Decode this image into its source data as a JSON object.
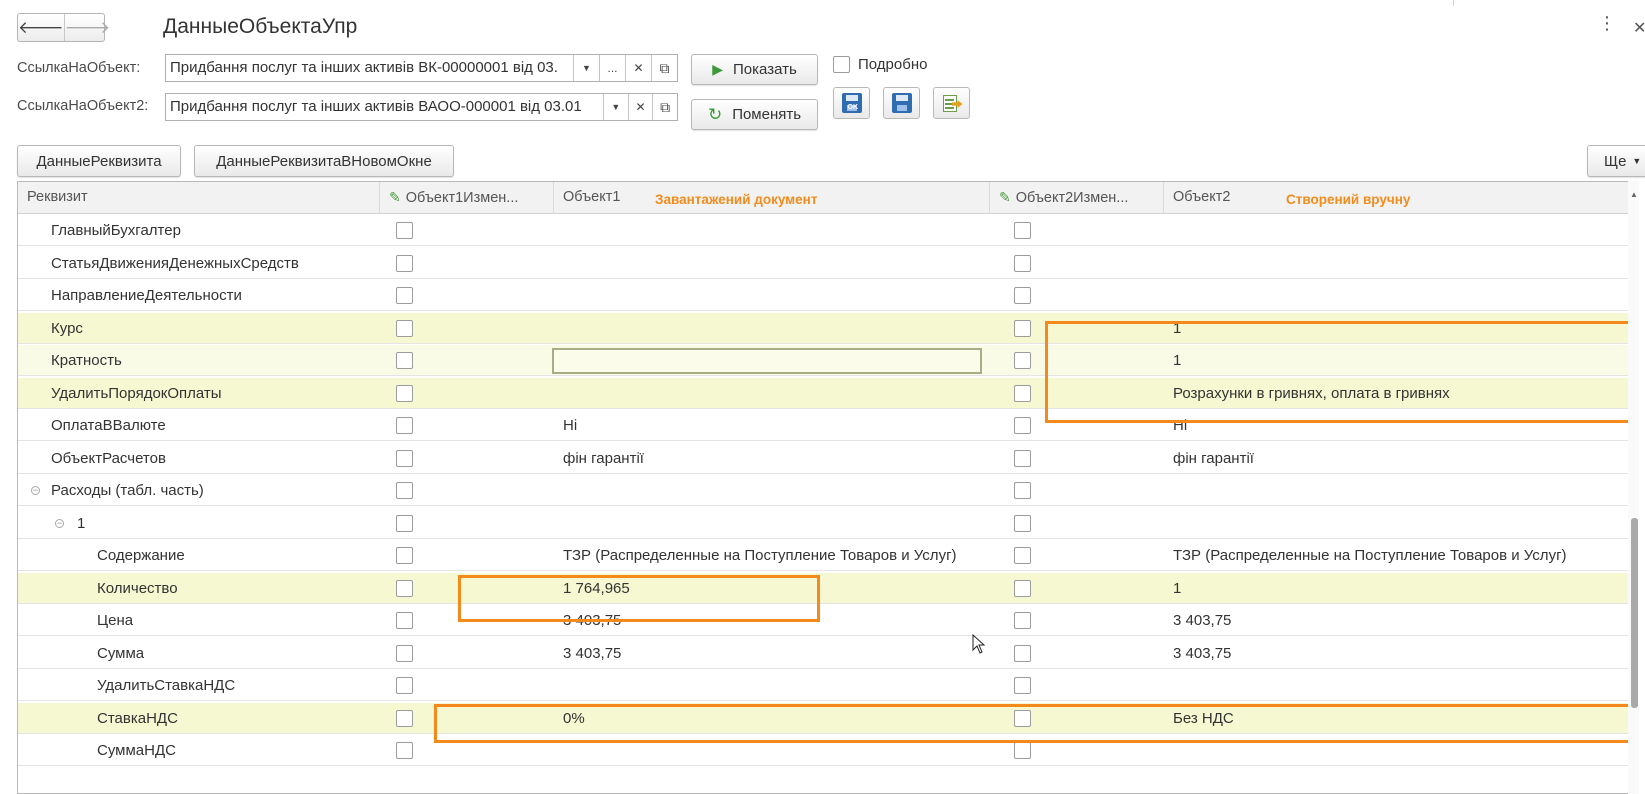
{
  "window": {
    "title": "ДанныеОбъектаУпр",
    "back_glyph": "🡐",
    "forward_glyph": "🡒"
  },
  "form": {
    "ref1_label": "СсылкаНаОбъект:",
    "ref1_value": "Придбання послуг та інших активів ВК-00000001 від 03.",
    "ref2_label": "СсылкаНаОбъект2:",
    "ref2_value": "Придбання послуг та інших активів ВАОО-000001 від 03.01",
    "show_button": "Показать",
    "swap_button": "Поменять",
    "detail_label": "Подробно",
    "detail_checked": false,
    "attr_data_button": "ДанныеРеквизита",
    "attr_data_new_window_button": "ДанныеРеквизитаВНовомОкне",
    "more_button": "Ще",
    "save_ok_label": "OK"
  },
  "grid": {
    "columns": {
      "attribute": "Реквизит",
      "obj1_changed": "Объект1Измен...",
      "obj1": "Объект1",
      "obj1_note": "Завантажений документ",
      "obj2_changed": "Объект2Измен...",
      "obj2": "Объект2",
      "obj2_note": "Створений вручну"
    },
    "rows": [
      {
        "name": "ГлавныйБухгалтер",
        "obj1": "",
        "obj2": ""
      },
      {
        "name": "СтатьяДвиженияДенежныхСредств",
        "obj1": "",
        "obj2": ""
      },
      {
        "name": "НаправлениеДеятельности",
        "obj1": "",
        "obj2": ""
      },
      {
        "name": "Курс",
        "obj1": "",
        "obj2": "1"
      },
      {
        "name": "Кратность",
        "obj1": "",
        "obj2": "1"
      },
      {
        "name": "УдалитьПорядокОплаты",
        "obj1": "",
        "obj2": "Розрахунки в гривнях, оплата в гривнях"
      },
      {
        "name": "ОплатаВВалюте",
        "obj1": "Ні",
        "obj2": "Ні"
      },
      {
        "name": "ОбъектРасчетов",
        "obj1": "фін гарантії",
        "obj2": "фін гарантії"
      },
      {
        "name": "Расходы (табл. часть)",
        "obj1": "",
        "obj2": ""
      },
      {
        "name": "1",
        "obj1": "",
        "obj2": ""
      },
      {
        "name": "Содержание",
        "obj1": "ТЗР (Распределенные на Поступление Товаров и Услуг)",
        "obj2": "ТЗР (Распределенные на Поступление Товаров и Услуг)"
      },
      {
        "name": "Количество",
        "obj1": "1 764,965",
        "obj2": "1"
      },
      {
        "name": "Цена",
        "obj1": "3 403,75",
        "obj2": "3 403,75"
      },
      {
        "name": "Сумма",
        "obj1": "3 403,75",
        "obj2": "3 403,75"
      },
      {
        "name": "УдалитьСтавкаНДС",
        "obj1": "",
        "obj2": ""
      },
      {
        "name": "СтавкаНДС",
        "obj1": "0%",
        "obj2": "Без НДС"
      },
      {
        "name": "СуммаНДС",
        "obj1": "",
        "obj2": ""
      }
    ]
  },
  "colors": {
    "highlight_row": "#f5f8d0",
    "annotation": "#f58a1c"
  }
}
